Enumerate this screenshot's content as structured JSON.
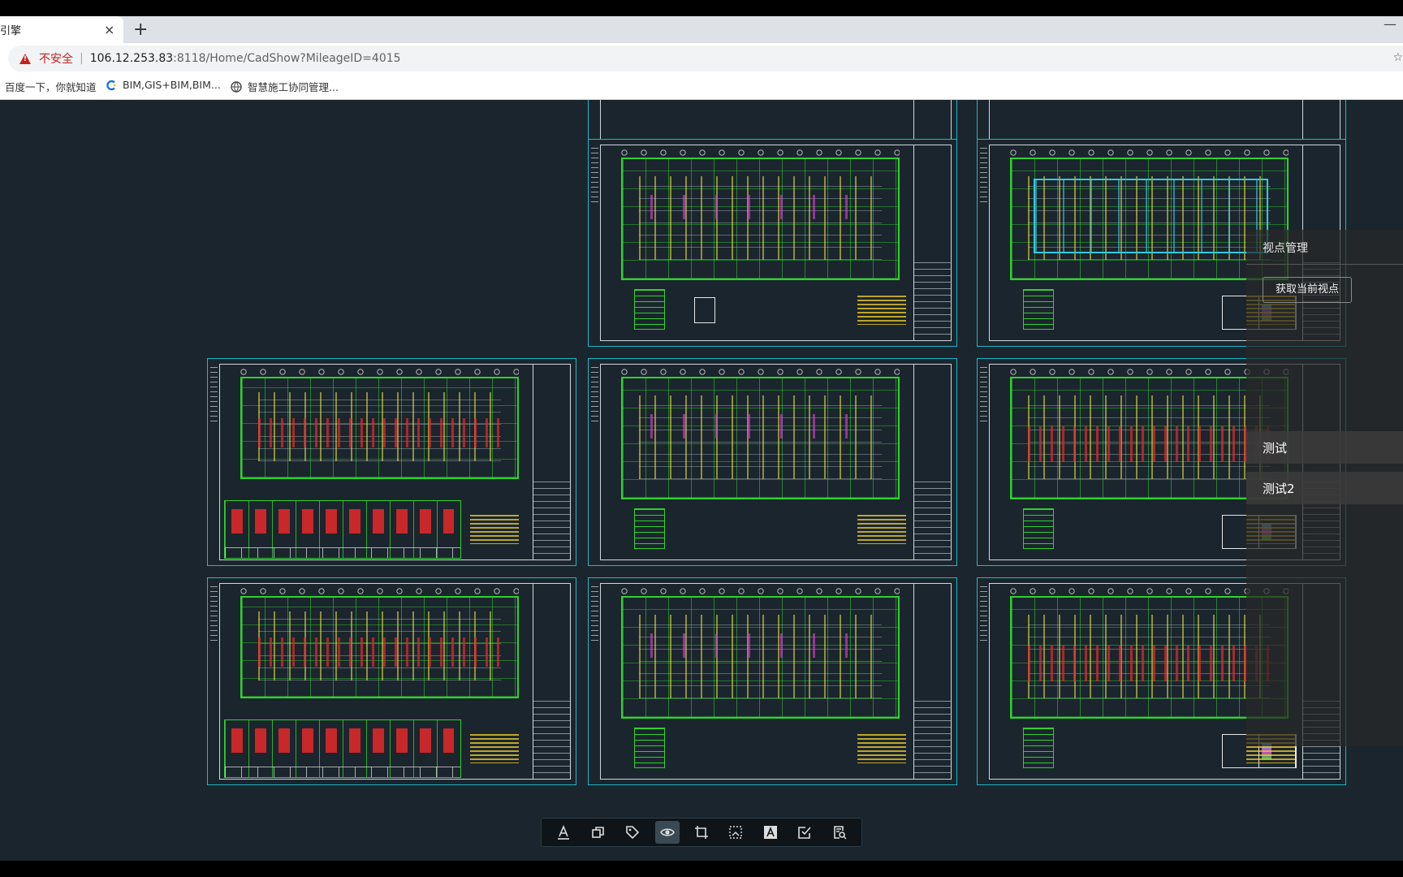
{
  "browser": {
    "tab_title": "引擎",
    "tab_close": "×",
    "new_tab": "+",
    "minimize": "—",
    "security_label": "不安全",
    "separator": "|",
    "url_host": "106.12.253.83",
    "url_rest": ":8118/Home/CadShow?MileageID=4015",
    "star": "☆",
    "bookmarks": [
      {
        "label": "百度一下，你就知道",
        "icon": "none"
      },
      {
        "label": "BIM,GIS+BIM,BIM...",
        "icon": "c-logo-icon"
      },
      {
        "label": "智慧施工协同管理...",
        "icon": "globe-icon"
      }
    ]
  },
  "side_panel": {
    "title": "视点管理",
    "get_view_button": "获取当前视点",
    "viewpoints": [
      {
        "label": "测试"
      },
      {
        "label": "测试2"
      }
    ]
  },
  "toolbar": {
    "tools": [
      {
        "name": "text-annotation-icon",
        "active": false
      },
      {
        "name": "copy-layers-icon",
        "active": false
      },
      {
        "name": "tag-icon",
        "active": false
      },
      {
        "name": "eye-icon",
        "active": true
      },
      {
        "name": "crop-frame-icon",
        "active": false
      },
      {
        "name": "measure-area-icon",
        "active": false
      },
      {
        "name": "text-style-icon",
        "active": false
      },
      {
        "name": "checkbox-icon",
        "active": false
      },
      {
        "name": "document-search-icon",
        "active": false
      }
    ]
  },
  "colors": {
    "canvas_bg": "#1b252d",
    "sheet_border": "#1fb7c9",
    "cad_green": "#2fd12f",
    "cad_yellow": "#e7c52b",
    "cad_red": "#e62828",
    "cad_magenta": "#d23cd2",
    "warning_red": "#c5221f"
  }
}
